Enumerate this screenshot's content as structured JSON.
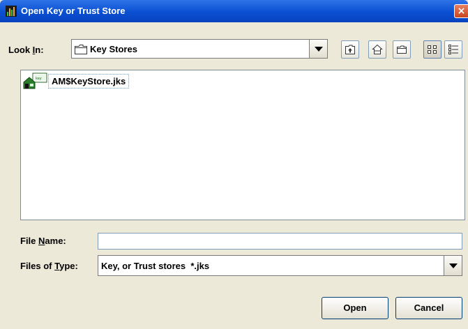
{
  "window": {
    "title": "Open Key or Trust Store",
    "close_glyph": "×"
  },
  "look_in": {
    "label_prefix": "Look ",
    "label_mnemonic": "I",
    "label_suffix": "n:",
    "value": "Key Stores"
  },
  "toolbar": {
    "icons": [
      "up-one-level-icon",
      "home-icon",
      "new-folder-icon",
      "list-view-icon",
      "details-view-icon"
    ],
    "active_view": "list-view"
  },
  "files": [
    {
      "name": "AM$KeyStore.jks",
      "icon": "keystore-icon"
    }
  ],
  "file_name": {
    "label_prefix": "File ",
    "label_mnemonic": "N",
    "label_suffix": "ame:",
    "value": ""
  },
  "files_of_type": {
    "label_prefix": "Files of ",
    "label_mnemonic": "T",
    "label_suffix": "ype:",
    "value": "Key, or Trust stores  *.jks"
  },
  "buttons": {
    "open": "Open",
    "cancel": "Cancel"
  },
  "colors": {
    "titlebar": "#0a4fd1",
    "window_bg": "#ece9d8",
    "button_border": "#003c74"
  }
}
